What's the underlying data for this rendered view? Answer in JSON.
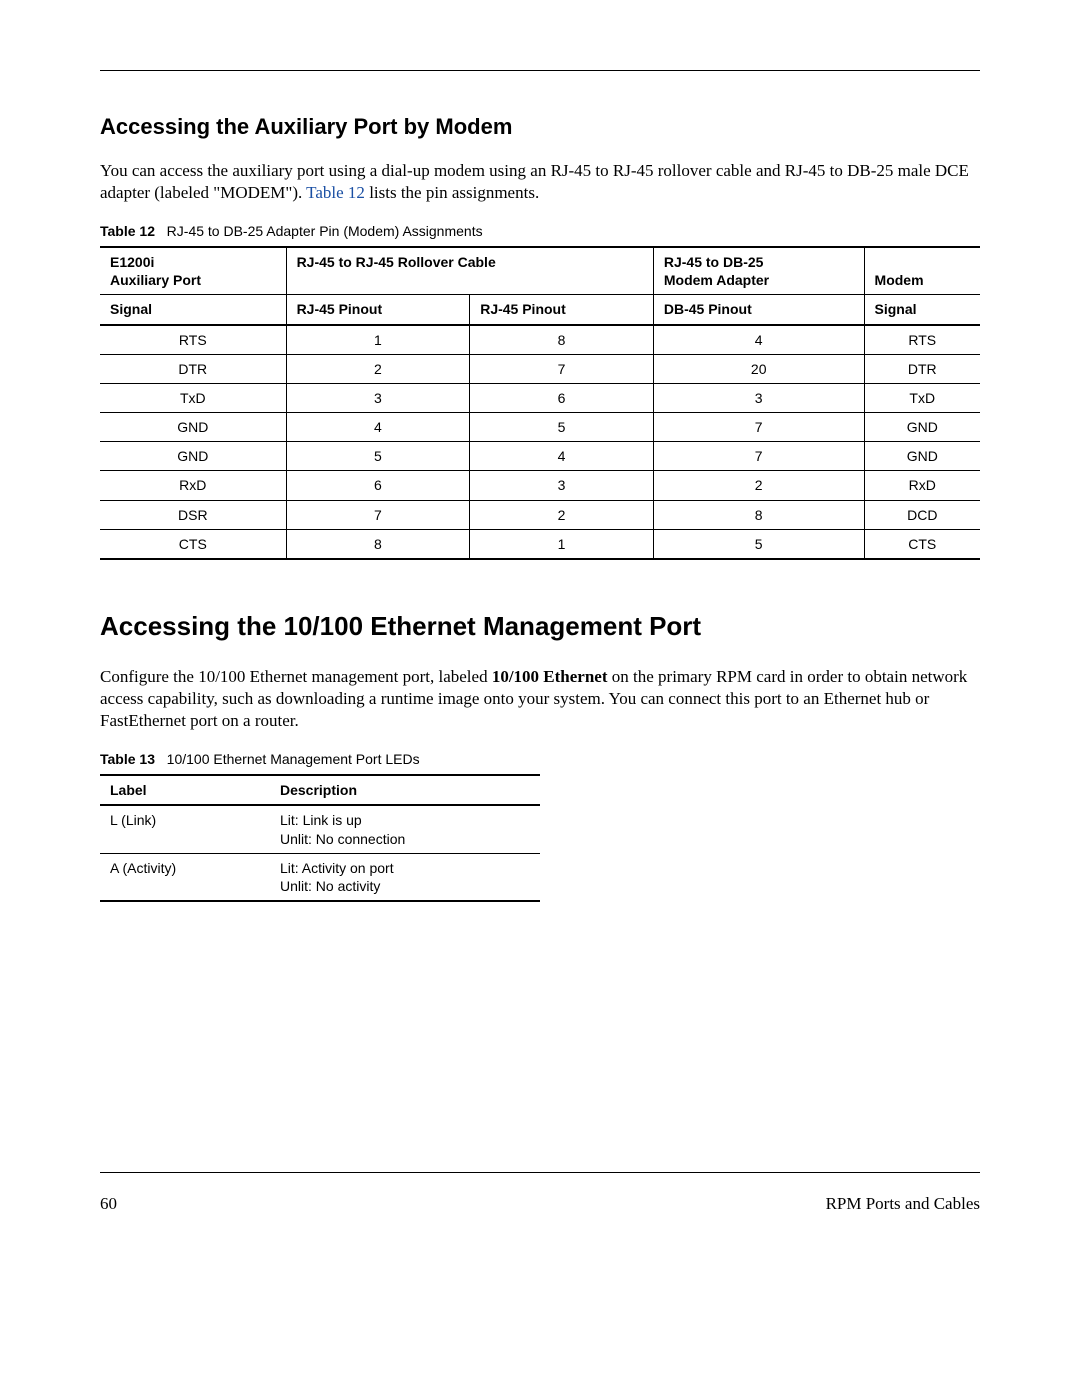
{
  "heading1": "Accessing the Auxiliary Port by Modem",
  "para1_a": "You can access the auxiliary port using a dial-up modem using an RJ-45 to RJ-45 rollover cable and RJ-45 to DB-25 male DCE adapter (labeled \"MODEM\"). ",
  "para1_link": "Table 12",
  "para1_b": " lists the pin assignments.",
  "table12_label": "Table 12",
  "table12_title": "RJ-45 to DB-25 Adapter Pin (Modem) Assignments",
  "table12": {
    "head_r1": {
      "c1a": "E1200i",
      "c1b": "Auxiliary Port",
      "c2": "RJ-45 to RJ-45 Rollover Cable",
      "c3a": "RJ-45 to DB-25",
      "c3b": "Modem Adapter",
      "c4": "Modem"
    },
    "head_r2": {
      "c1": "Signal",
      "c2": "RJ-45 Pinout",
      "c3": "RJ-45 Pinout",
      "c4": "DB-45 Pinout",
      "c5": "Signal"
    },
    "rows": [
      {
        "sig1": "RTS",
        "p1": "1",
        "p2": "8",
        "p3": "4",
        "sig2": "RTS"
      },
      {
        "sig1": "DTR",
        "p1": "2",
        "p2": "7",
        "p3": "20",
        "sig2": "DTR"
      },
      {
        "sig1": "TxD",
        "p1": "3",
        "p2": "6",
        "p3": "3",
        "sig2": "TxD"
      },
      {
        "sig1": "GND",
        "p1": "4",
        "p2": "5",
        "p3": "7",
        "sig2": "GND"
      },
      {
        "sig1": "GND",
        "p1": "5",
        "p2": "4",
        "p3": "7",
        "sig2": "GND"
      },
      {
        "sig1": "RxD",
        "p1": "6",
        "p2": "3",
        "p3": "2",
        "sig2": "RxD"
      },
      {
        "sig1": "DSR",
        "p1": "7",
        "p2": "2",
        "p3": "8",
        "sig2": "DCD"
      },
      {
        "sig1": "CTS",
        "p1": "8",
        "p2": "1",
        "p3": "5",
        "sig2": "CTS"
      }
    ]
  },
  "heading2": "Accessing the 10/100 Ethernet Management Port",
  "para2_a": "Configure the 10/100 Ethernet management port, labeled ",
  "para2_bold": "10/100 Ethernet",
  "para2_b": " on the primary RPM card in order to obtain network access capability, such as downloading a runtime image onto your system. You can connect this port to an Ethernet hub or FastEthernet port on a router.",
  "table13_label": "Table 13",
  "table13_title": "10/100 Ethernet Management Port LEDs",
  "table13": {
    "h1": "Label",
    "h2": "Description",
    "rows": [
      {
        "label": "L (Link)",
        "d1": "Lit: Link is up",
        "d2": "Unlit: No connection"
      },
      {
        "label": "A (Activity)",
        "d1": "Lit: Activity on port",
        "d2": "Unlit: No activity"
      }
    ]
  },
  "footer_page": "60",
  "footer_text": "RPM Ports and Cables"
}
